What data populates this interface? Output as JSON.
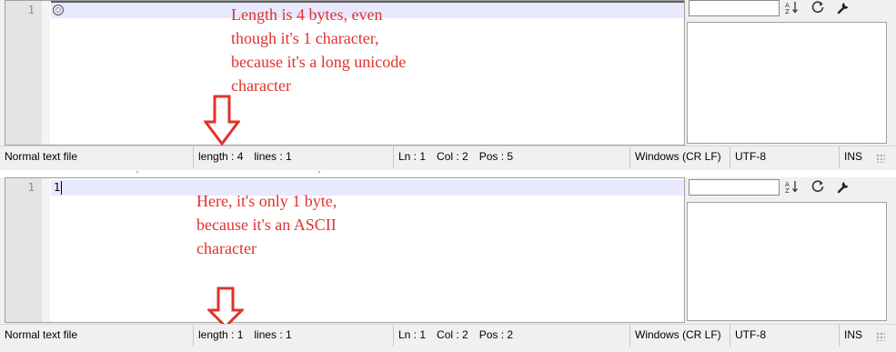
{
  "panes": [
    {
      "line_number": "1",
      "line_text": "",
      "annotation": "Length is 4 bytes, even\nthough it's 1 character,\nbecause it's a long unicode\ncharacter",
      "status": {
        "file_type": "Normal text file",
        "length": "length : 4",
        "lines": "lines : 1",
        "ln": "Ln : 1",
        "col": "Col : 2",
        "pos": "Pos : 5",
        "eol": "Windows (CR LF)",
        "encoding": "UTF-8",
        "mode": "INS"
      }
    },
    {
      "line_number": "1",
      "line_text": "1",
      "annotation": "Here, it's only 1 byte,\nbecause it's an ASCII\ncharacter",
      "status": {
        "file_type": "Normal text file",
        "length": "length : 1",
        "lines": "lines : 1",
        "ln": "Ln : 1",
        "col": "Col : 2",
        "pos": "Pos : 2",
        "eol": "Windows (CR LF)",
        "encoding": "UTF-8",
        "mode": "INS"
      }
    }
  ],
  "icons": {
    "sort": "sort-az-icon",
    "refresh": "refresh-icon",
    "settings": "wrench-icon"
  },
  "colors": {
    "annotation": "#e0322c",
    "current_line": "#e8e8ff",
    "gutter": "#e4e4e4"
  }
}
